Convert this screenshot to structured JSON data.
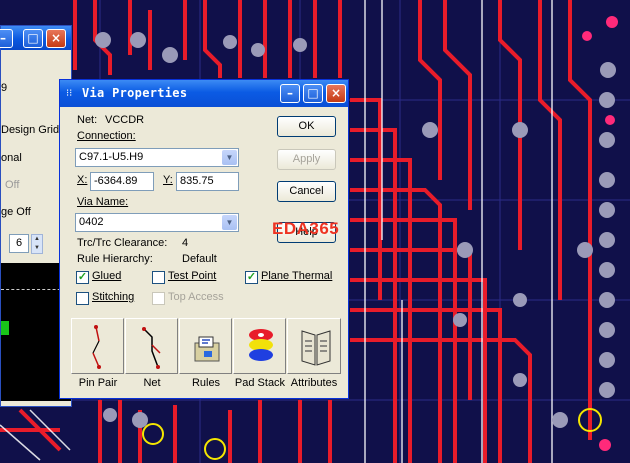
{
  "background_window": {
    "texts": [
      "9",
      "Design Grid",
      "onal",
      "Off",
      "ge Off"
    ],
    "spin_value": "6"
  },
  "dialog": {
    "title": "Via Properties",
    "net_label": "Net:",
    "net_value": "VCCDR",
    "connection_label": "Connection:",
    "connection_value": "C97.1-U5.H9",
    "x_label": "X:",
    "x_value": "-6364.89",
    "y_label": "Y:",
    "y_value": "835.75",
    "via_name_label": "Via Name:",
    "via_name_value": "0402",
    "clearance_label": "Trc/Trc Clearance:",
    "clearance_value": "4",
    "rule_hierarchy_label": "Rule Hierarchy:",
    "rule_hierarchy_value": "Default",
    "ok_label": "OK",
    "apply_label": "Apply",
    "cancel_label": "Cancel",
    "help_label": "Help",
    "checkboxes": {
      "glued": {
        "label": "Glued",
        "checked": true
      },
      "test_point": {
        "label": "Test Point",
        "checked": false
      },
      "plane_thermal": {
        "label": "Plane Thermal",
        "checked": true
      },
      "stitching": {
        "label": "Stitching",
        "checked": false
      },
      "top_access": {
        "label": "Top Access",
        "checked": false
      }
    },
    "tools": [
      "Pin Pair",
      "Net",
      "Rules",
      "Pad Stack",
      "Attributes"
    ]
  },
  "watermark": "EDA365",
  "colors": {
    "title_blue": "#0b5be4",
    "dialog_bg": "#ece9d8",
    "trace_red": "#e81c2a",
    "board_bg": "#10104a",
    "pad_grey": "#9a9ab8",
    "marker_yellow": "#f5e600"
  }
}
